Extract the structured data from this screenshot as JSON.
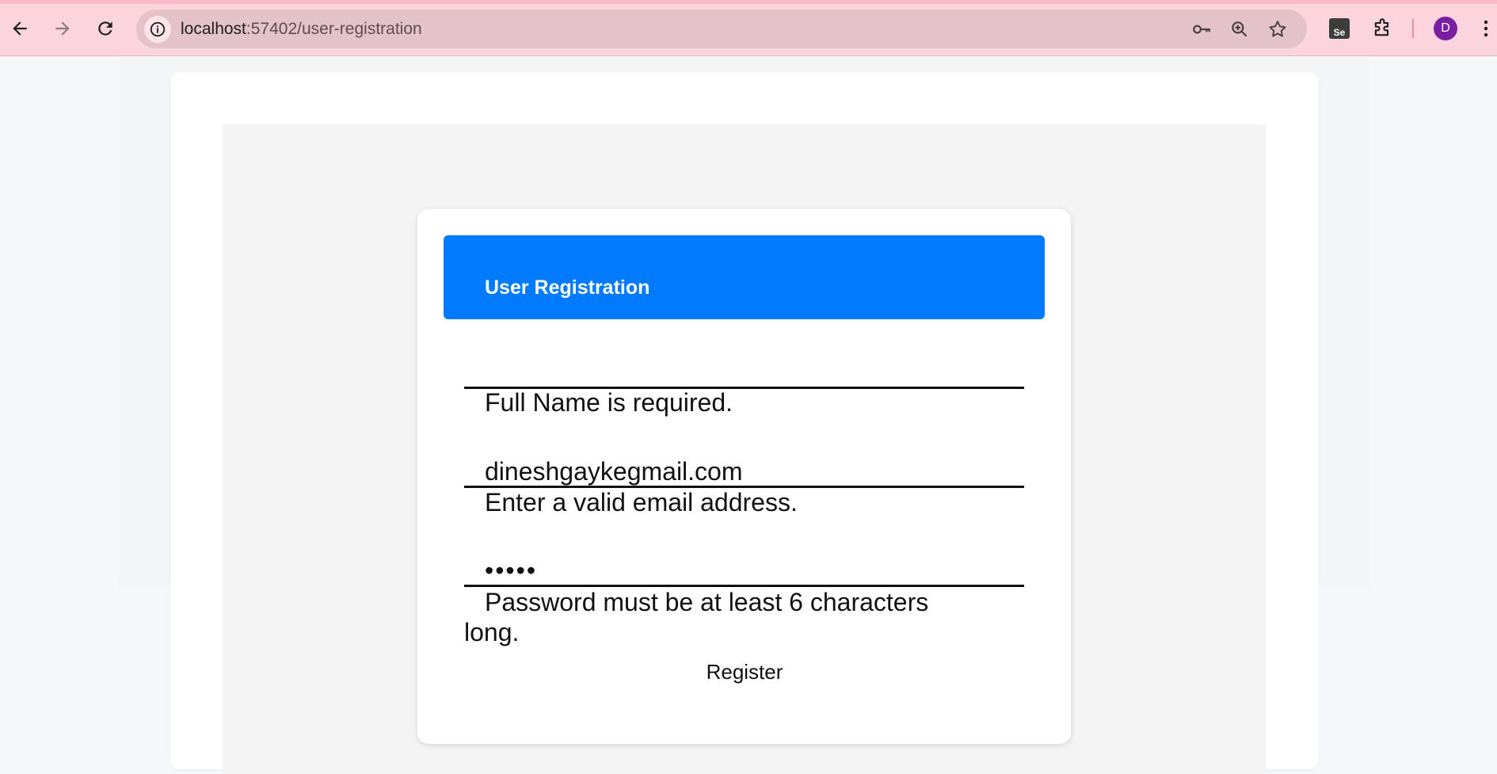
{
  "browser": {
    "url_host": "localhost",
    "url_path": ":57402/user-registration",
    "se_extension_label": "Se",
    "profile_initial": "D"
  },
  "form": {
    "title": "User Registration",
    "full_name": {
      "value": "",
      "error": "Full Name is required."
    },
    "email": {
      "value": "dineshgaykegmail.com",
      "error": "Enter a valid email address."
    },
    "password": {
      "value": "•••••",
      "error_line1": "Password must be at least 6 characters",
      "error_line2": "long."
    },
    "register_label": "Register"
  },
  "colors": {
    "header_blue": "#007bff",
    "browser_chrome": "#fbd4de",
    "avatar": "#7b1fa2"
  }
}
